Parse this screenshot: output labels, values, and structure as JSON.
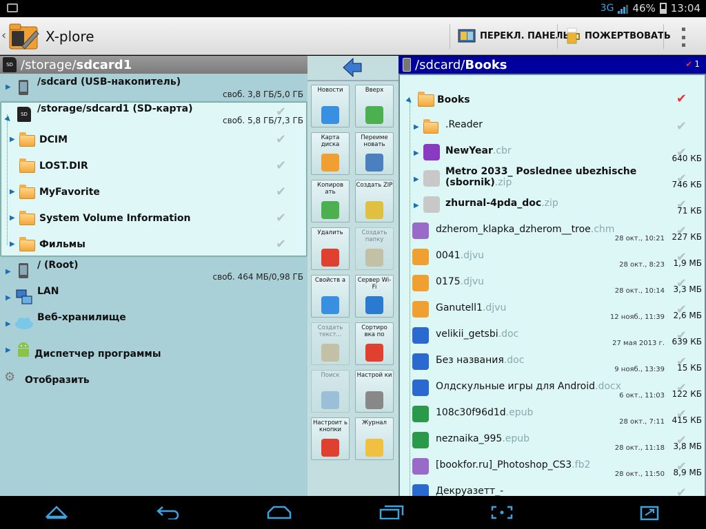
{
  "status_bar": {
    "network": "3G",
    "battery": "46%",
    "time": "13:04"
  },
  "app": {
    "title": "X-plore"
  },
  "actions": {
    "switch_panel": "ПЕРЕКЛ. ПАНЕЛЬ",
    "donate": "ПОЖЕРТВОВАТЬ"
  },
  "left": {
    "header_prefix": "/storage/",
    "header_bold": "sdcard1",
    "nodes": [
      {
        "name": "/sdcard (USB-накопитель)",
        "free": "своб. 3,8 ГБ/5,0 ГБ"
      },
      {
        "name": "/storage/sdcard1 (SD-карта)",
        "free": "своб. 5,8 ГБ/7,3 ГБ"
      },
      {
        "name": "/ (Root)",
        "free": "своб. 464 МБ/0,98 ГБ"
      },
      {
        "name": "LAN"
      },
      {
        "name": "Веб-хранилище"
      },
      {
        "name": "Диспетчер программы"
      },
      {
        "name": "Отобразить"
      }
    ],
    "folders": [
      "DCIM",
      "LOST.DIR",
      "MyFavorite",
      "System Volume Information",
      "Фильмы"
    ]
  },
  "toolbar": [
    {
      "label": "Новости",
      "enabled": true,
      "icon": "info-icon"
    },
    {
      "label": "Вверх",
      "enabled": true,
      "icon": "up-arrow-icon"
    },
    {
      "label": "Карта диска",
      "enabled": true,
      "icon": "disk-map-icon"
    },
    {
      "label": "Переиме новать",
      "enabled": true,
      "icon": "rename-icon"
    },
    {
      "label": "Копиров ать",
      "enabled": true,
      "icon": "copy-icon"
    },
    {
      "label": "Создать ZIP",
      "enabled": true,
      "icon": "zip-icon"
    },
    {
      "label": "Удалить",
      "enabled": true,
      "icon": "trash-icon"
    },
    {
      "label": "Создать папку",
      "enabled": false,
      "icon": "new-folder-icon"
    },
    {
      "label": "Свойств а",
      "enabled": true,
      "icon": "properties-icon"
    },
    {
      "label": "Сервер Wi-Fi",
      "enabled": true,
      "icon": "wifi-icon"
    },
    {
      "label": "Создать текст...",
      "enabled": false,
      "icon": "new-text-icon"
    },
    {
      "label": "Сортиро вка по",
      "enabled": true,
      "icon": "sort-icon"
    },
    {
      "label": "Поиск",
      "enabled": false,
      "icon": "search-icon"
    },
    {
      "label": "Настрой ки",
      "enabled": true,
      "icon": "gear-icon"
    },
    {
      "label": "Настроит ь кнопки",
      "enabled": true,
      "icon": "buttons-icon"
    },
    {
      "label": "Журнал",
      "enabled": true,
      "icon": "journal-icon"
    }
  ],
  "right": {
    "header_prefix": "/sdcard/",
    "header_bold": "Books",
    "checked_count": "1",
    "folder": "Books",
    "items": [
      {
        "name": ".Reader",
        "ext": "",
        "date": "",
        "size": "",
        "icon": "folder-icon",
        "bold": false
      },
      {
        "name": "NewYear",
        "ext": ".cbr",
        "date": "",
        "size": "640 КБ",
        "icon": "archive-icon",
        "bold": true
      },
      {
        "name": "Metro 2033_ Poslednee ubezhische",
        "name2": "(sbornik)",
        "ext": ".zip",
        "date": "",
        "size": "746 КБ",
        "icon": "zip-icon",
        "bold": true
      },
      {
        "name": "zhurnal-4pda_doc",
        "ext": ".zip",
        "date": "",
        "size": "71 КБ",
        "icon": "zip-icon",
        "bold": true
      },
      {
        "name": "dzherom_klapka_dzherom__troe",
        "ext": ".chm",
        "date": "28 окт., 10:21",
        "size": "227 КБ",
        "icon": "puzzle-icon",
        "bold": false
      },
      {
        "name": "0041",
        "ext": ".djvu",
        "date": "28 окт., 8:23",
        "size": "1,9 МБ",
        "icon": "djvu-icon",
        "bold": false
      },
      {
        "name": "0175",
        "ext": ".djvu",
        "date": "28 окт., 10:14",
        "size": "3,3 МБ",
        "icon": "djvu-icon",
        "bold": false
      },
      {
        "name": "Ganutell1",
        "ext": ".djvu",
        "date": "12 нояб., 11:39",
        "size": "2,6 МБ",
        "icon": "djvu-icon",
        "bold": false
      },
      {
        "name": "velikii_getsbi",
        "ext": ".doc",
        "date": "27 мая 2013 г.",
        "size": "639 КБ",
        "icon": "doc-icon",
        "bold": false
      },
      {
        "name": "Без названия",
        "ext": ".doc",
        "date": "9 нояб., 13:39",
        "size": "15 КБ",
        "icon": "doc-icon",
        "bold": false
      },
      {
        "name": "Олдскульные игры для Android",
        "ext": ".docx",
        "date": "6 окт., 11:03",
        "size": "122 КБ",
        "icon": "doc-icon",
        "bold": false
      },
      {
        "name": "108c30f96d1d",
        "ext": ".epub",
        "date": "28 окт., 7:11",
        "size": "415 КБ",
        "icon": "epub-icon",
        "bold": false
      },
      {
        "name": "neznaika_995",
        "ext": ".epub",
        "date": "28 окт., 11:18",
        "size": "3,8 МБ",
        "icon": "epub-icon",
        "bold": false
      },
      {
        "name": "[bookfor.ru]_Photoshop_CS3",
        "ext": ".fb2",
        "date": "28 окт., 11:50",
        "size": "8,9 МБ",
        "icon": "puzzle-icon",
        "bold": false
      },
      {
        "name": "Декруазетт_-",
        "ext": "",
        "date": "",
        "size": "",
        "icon": "doc-icon",
        "bold": false
      }
    ]
  }
}
